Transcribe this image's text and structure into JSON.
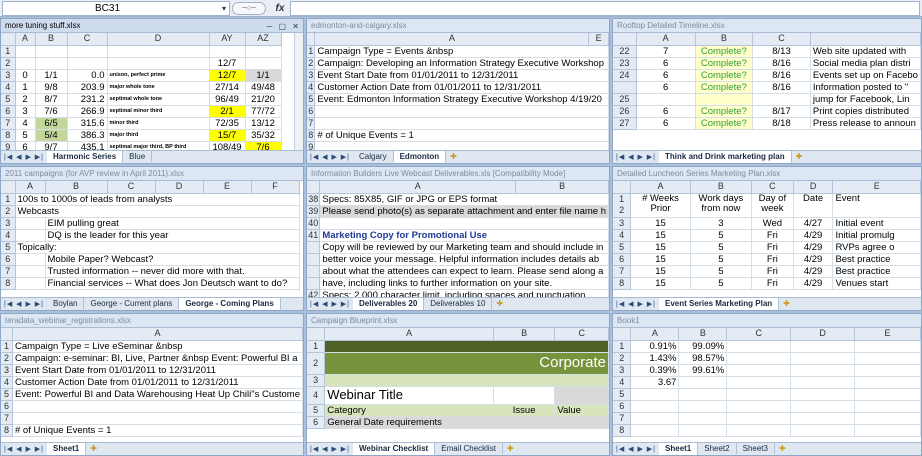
{
  "formula_bar": {
    "name_box": "BC31",
    "dropdown": "▾",
    "zoom": "─○─",
    "fx": "fx",
    "formula": ""
  },
  "win1": {
    "title": "more tuning stuff.xlsx",
    "cols": [
      "",
      "A",
      "B",
      "C",
      "D",
      "AY",
      "AZ"
    ],
    "rows": [
      {
        "n": "1",
        "a": "",
        "b": "",
        "c": "",
        "d": "",
        "ay": "",
        "az": ""
      },
      {
        "n": "2",
        "a": "",
        "b": "",
        "c": "",
        "d": "",
        "ay": "12/7",
        "az": ""
      },
      {
        "n": "3",
        "a": "0",
        "b": "1/1",
        "c": "0.0",
        "d": "unison, perfect prime",
        "ay": "12/7",
        "az": "1/1"
      },
      {
        "n": "4",
        "a": "1",
        "b": "9/8",
        "c": "203.9",
        "d": "major whole tone",
        "ay": "27/14",
        "az": "49/48"
      },
      {
        "n": "5",
        "a": "2",
        "b": "8/7",
        "c": "231.2",
        "d": "septimal whole tone",
        "ay": "96/49",
        "az": "21/20"
      },
      {
        "n": "6",
        "a": "3",
        "b": "7/6",
        "c": "266.9",
        "d": "septimal minor third",
        "ay": "2/1",
        "az": "77/72"
      },
      {
        "n": "7",
        "a": "4",
        "b": "6/5",
        "c": "315.6",
        "d": "minor third",
        "ay": "72/35",
        "az": "13/12"
      },
      {
        "n": "8",
        "a": "5",
        "b": "5/4",
        "c": "386.3",
        "d": "major third",
        "ay": "15/7",
        "az": "35/32"
      },
      {
        "n": "9",
        "a": "6",
        "b": "9/7",
        "c": "435.1",
        "d": "septimal major third, BP third",
        "ay": "108/49",
        "az": "7/6"
      },
      {
        "n": "10",
        "a": "",
        "b": "",
        "c": "",
        "d": "",
        "ay": "",
        "az": ""
      }
    ],
    "tabs": [
      "Harmonic Series",
      "Blue"
    ]
  },
  "win2": {
    "title": "edmonton-and-calgary.xlsx",
    "cols": [
      "",
      "A",
      "E"
    ],
    "rows": [
      {
        "n": "1",
        "a": "Campaign Type = Events &nbsp"
      },
      {
        "n": "2",
        "a": "Campaign: Developing an Information Strategy Executive Workshop"
      },
      {
        "n": "3",
        "a": "Event Start Date from 01/01/2011 to 12/31/2011"
      },
      {
        "n": "4",
        "a": "Customer Action Date from 01/01/2011 to 12/31/2011"
      },
      {
        "n": "5",
        "a": "Event: Edmonton Information Strategy Executive Workshop 4/19/20"
      },
      {
        "n": "6",
        "a": ""
      },
      {
        "n": "7",
        "a": ""
      },
      {
        "n": "8",
        "a": "# of Unique Events = 1"
      },
      {
        "n": "9",
        "a": ""
      }
    ],
    "tabs": [
      "Calgary",
      "Edmonton"
    ]
  },
  "win3": {
    "title": "Rooftop Detailed Timeline.xlsx",
    "cols": [
      "",
      "A",
      "B",
      "C",
      ""
    ],
    "rows": [
      {
        "n": "22",
        "a": "7",
        "b": "Complete?",
        "c": "8/13",
        "d": "Web site updated with"
      },
      {
        "n": "23",
        "a": "6",
        "b": "Complete?",
        "c": "8/16",
        "d": "Social media plan distri"
      },
      {
        "n": "24",
        "a": "6",
        "b": "Complete?",
        "c": "8/16",
        "d": "Events set up on Facebo"
      },
      {
        "n": "",
        "a": "6",
        "b": "Complete?",
        "c": "8/16",
        "d": "Information posted to \""
      },
      {
        "n": "25",
        "a": "",
        "b": "",
        "c": "",
        "d": "jump for Facebook, Lin"
      },
      {
        "n": "26",
        "a": "6",
        "b": "Complete?",
        "c": "8/17",
        "d": "Print copies distributed"
      },
      {
        "n": "27",
        "a": "6",
        "b": "Complete?",
        "c": "8/18",
        "d": "Press release to announ"
      }
    ],
    "tabs": [
      "Think and Drink marketing plan"
    ]
  },
  "win4": {
    "title": "2011 campaigns (for AVP review in April 2011).xlsx",
    "cols": [
      "",
      "A",
      "B",
      "C",
      "D",
      "E",
      "F"
    ],
    "rows": [
      {
        "n": "1",
        "a": "100s to 1000s of leads from analysts",
        "x": ""
      },
      {
        "n": "2",
        "a": "Webcasts",
        "x": ""
      },
      {
        "n": "3",
        "a": "",
        "x": "EIM pulling great"
      },
      {
        "n": "4",
        "a": "",
        "x": "DQ is the leader for this year"
      },
      {
        "n": "5",
        "a": "Topically:",
        "x": ""
      },
      {
        "n": "6",
        "a": "",
        "x": "Mobile      Paper? Webcast?"
      },
      {
        "n": "7",
        "a": "",
        "x": "Trusted information -- never did more with that."
      },
      {
        "n": "8",
        "a": "",
        "x": "Financial services -- What does Jon Deutsch want to do?"
      }
    ],
    "tabs": [
      "Boylan",
      "George - Current plans",
      "George - Coming Plans"
    ]
  },
  "win5": {
    "title": "Information Builders Live Webcast Deliverables.xls  [Compatibility Mode]",
    "cols": [
      "",
      "A",
      "B"
    ],
    "rows": [
      {
        "n": "38",
        "a": "Specs:  85X85, GIF or JPG or EPS format"
      },
      {
        "n": "39",
        "a": "Please send photo(s) as separate attachment and enter file name h"
      },
      {
        "n": "40",
        "a": ""
      },
      {
        "n": "41",
        "a": "Marketing Copy for Promotional Use"
      },
      {
        "n": "",
        "a": "Copy will be reviewed by our Marketing team and should include in"
      },
      {
        "n": "",
        "a": "better voice your message.   Helpful information includes details ab"
      },
      {
        "n": "",
        "a": "about what the attendees can expect to learn.  Please send along a"
      },
      {
        "n": "",
        "a": "have, including links to further information on your site."
      },
      {
        "n": "42",
        "a": "Specs: 2,000 character limit, including spaces and punctuation"
      }
    ],
    "tabs": [
      "Deliverables 20",
      "Deliverables 10"
    ]
  },
  "win6": {
    "title": "Detailed Luncheon Series Marketing Plan.xlsx",
    "cols": [
      "",
      "A",
      "B",
      "C",
      "D",
      "E"
    ],
    "header": {
      "a": "# Weeks Prior",
      "b": "Work days from now",
      "c": "Day of week",
      "d": "Date",
      "e": "Event"
    },
    "rows": [
      {
        "n": "3",
        "a": "15",
        "b": "3",
        "c": "Wed",
        "d": "4/27",
        "e": "Initial event"
      },
      {
        "n": "4",
        "a": "15",
        "b": "5",
        "c": "Fri",
        "d": "4/29",
        "e": "Initial promulg"
      },
      {
        "n": "5",
        "a": "15",
        "b": "5",
        "c": "Fri",
        "d": "4/29",
        "e": "RVPs agree o"
      },
      {
        "n": "6",
        "a": "15",
        "b": "5",
        "c": "Fri",
        "d": "4/29",
        "e": "Best practice"
      },
      {
        "n": "7",
        "a": "15",
        "b": "5",
        "c": "Fri",
        "d": "4/29",
        "e": "Best practice"
      },
      {
        "n": "8",
        "a": "15",
        "b": "5",
        "c": "Fri",
        "d": "4/29",
        "e": "Venues start"
      }
    ],
    "tabs": [
      "Event Series Marketing Plan"
    ]
  },
  "win7": {
    "title": "teradata_webinar_registrations.xlsx",
    "cols": [
      "",
      "A"
    ],
    "rows": [
      {
        "n": "1",
        "a": "Campaign Type = Live eSeminar &nbsp"
      },
      {
        "n": "2",
        "a": "Campaign: e-seminar: BI, Live, Partner &nbsp Event: Powerful BI a"
      },
      {
        "n": "3",
        "a": "Event Start Date from 01/01/2011 to 12/31/2011"
      },
      {
        "n": "4",
        "a": "Customer Action Date from 01/01/2011 to 12/31/2011"
      },
      {
        "n": "5",
        "a": "Event: Powerful BI and Data Warehousing Heat Up Chili\"s Custome"
      },
      {
        "n": "6",
        "a": ""
      },
      {
        "n": "7",
        "a": ""
      },
      {
        "n": "8",
        "a": "# of Unique Events = 1"
      }
    ],
    "tabs": [
      "Sheet1"
    ]
  },
  "win8": {
    "title": "Campaign Blueprint.xlsx",
    "cols": [
      "",
      "A",
      "B",
      "C"
    ],
    "corporate": "Corporate",
    "webinar": "Webinar Title",
    "category": "Category",
    "issue": "Issue",
    "value": "Value",
    "general": "General Date requirements",
    "rows": [
      "1",
      "2",
      "3",
      "4",
      "5",
      "6"
    ],
    "tabs": [
      "Webinar Checklist",
      "Email Checklist"
    ]
  },
  "win9": {
    "title": "Book1",
    "cols": [
      "",
      "A",
      "B",
      "C",
      "D",
      "E"
    ],
    "rows": [
      {
        "n": "1",
        "a": "0.91%",
        "b": "99.09%"
      },
      {
        "n": "2",
        "a": "1.43%",
        "b": "98.57%"
      },
      {
        "n": "3",
        "a": "0.39%",
        "b": "99.61%"
      },
      {
        "n": "4",
        "a": "3.67",
        "b": ""
      },
      {
        "n": "5",
        "a": "",
        "b": ""
      },
      {
        "n": "6",
        "a": "",
        "b": ""
      },
      {
        "n": "7",
        "a": "",
        "b": ""
      },
      {
        "n": "8",
        "a": "",
        "b": ""
      }
    ],
    "tabs": [
      "Sheet1",
      "Sheet2",
      "Sheet3"
    ]
  },
  "nav_arrows": "|◀ ◀ ▶ ▶|"
}
